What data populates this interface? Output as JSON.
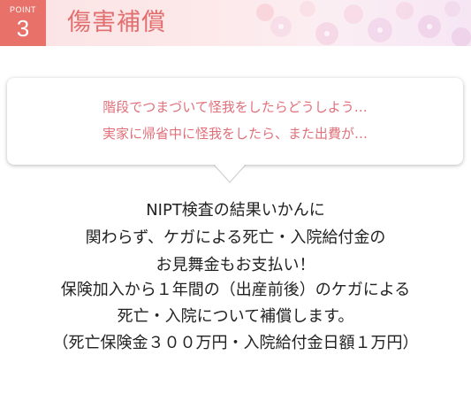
{
  "header": {
    "point_label": "POINT",
    "point_number": "3",
    "title": "傷害補償"
  },
  "bubble": {
    "lines": [
      "階段でつまづいて怪我をしたらどうしよう…",
      "実家に帰省中に怪我をしたら、また出費が…"
    ]
  },
  "body": {
    "lines": [
      "NIPT検査の結果いかんに",
      "関わらず、ケガによる死亡・入院給付金の",
      "お見舞金もお支払い！",
      "保険加入から１年間の（出産前後）のケガによる",
      "死亡・入院について補償します。",
      "（死亡保険金３００万円・入院給付金日額１万円）"
    ]
  },
  "colors": {
    "accent": "#e8726a",
    "title": "#e26f6f",
    "bubble_text": "#e0707a",
    "body_text": "#222222"
  }
}
